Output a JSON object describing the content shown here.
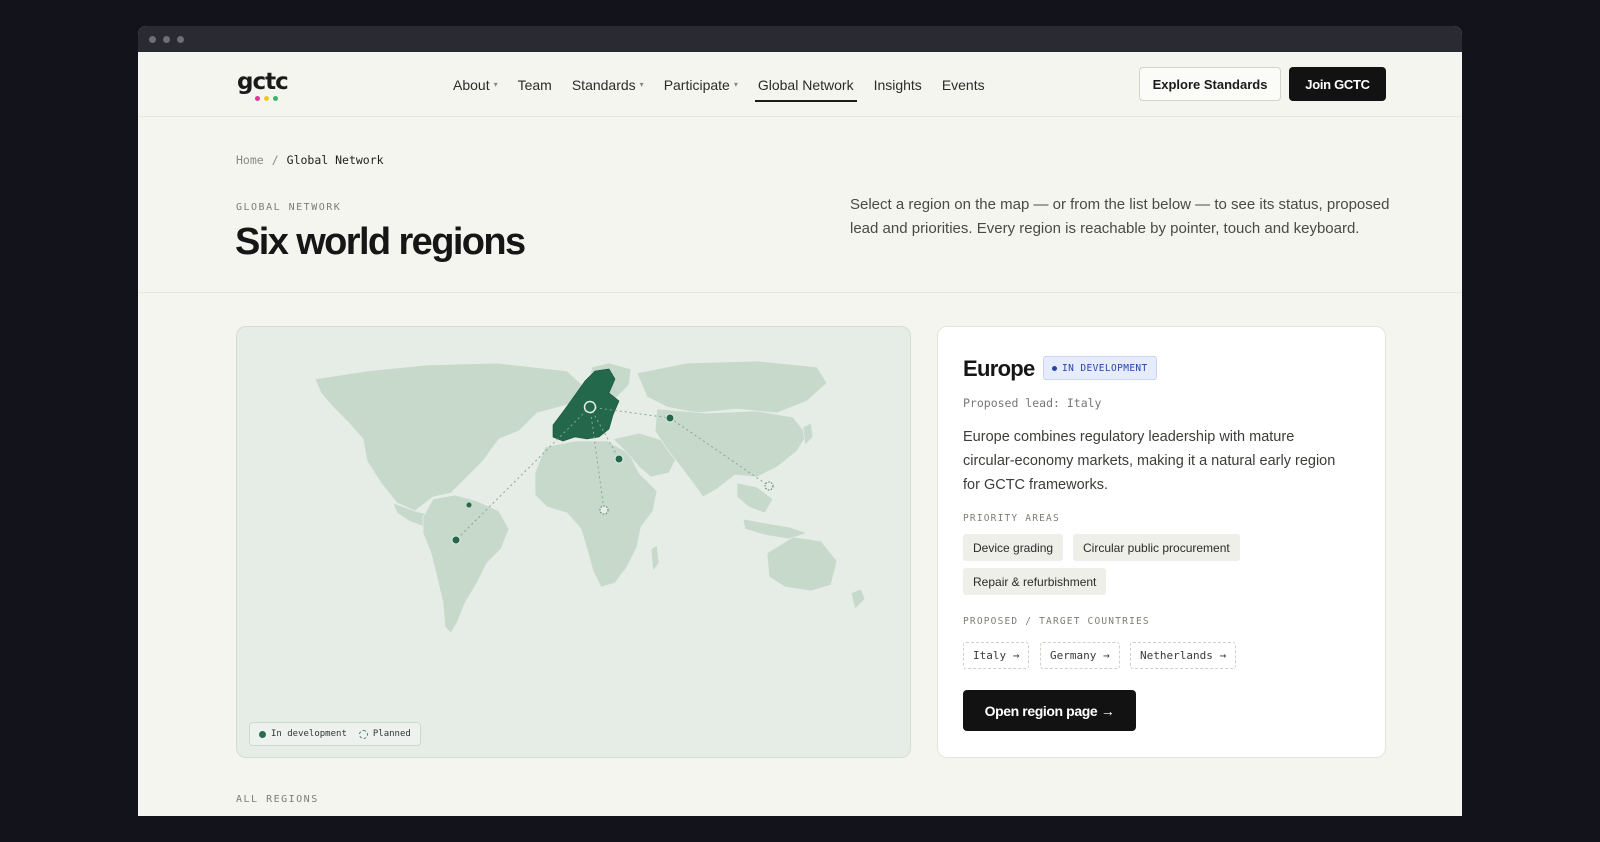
{
  "logo": {
    "text": "gctc",
    "dot_colors": [
      "#e0399a",
      "#f2c530",
      "#35b56a"
    ]
  },
  "nav": {
    "items": [
      {
        "label": "About",
        "dropdown": true
      },
      {
        "label": "Team",
        "dropdown": false
      },
      {
        "label": "Standards",
        "dropdown": true
      },
      {
        "label": "Participate",
        "dropdown": true
      },
      {
        "label": "Global Network",
        "dropdown": false,
        "active": true
      },
      {
        "label": "Insights",
        "dropdown": false
      },
      {
        "label": "Events",
        "dropdown": false
      }
    ],
    "explore_label": "Explore Standards",
    "join_label": "Join GCTC"
  },
  "breadcrumb": {
    "home": "Home",
    "separator": "/",
    "current": "Global Network"
  },
  "hero": {
    "eyebrow": "GLOBAL NETWORK",
    "title": "Six world regions",
    "lead": "Select a region on the map — or from the list below — to see its status, proposed lead and priorities. Every region is reachable by pointer, touch and keyboard."
  },
  "map": {
    "legend": {
      "in_development": "In development",
      "planned": "Planned"
    },
    "colors": {
      "land": "#c6d9ca",
      "highlight": "#23684a",
      "water": "#e6ece6"
    }
  },
  "panel": {
    "title": "Europe",
    "status": "IN DEVELOPMENT",
    "proposed_lead": "Proposed lead: Italy",
    "description": "Europe combines regulatory leadership with mature circular-economy markets, making it a natural early region for GCTC frameworks.",
    "priority_label": "PRIORITY AREAS",
    "priority_areas": [
      "Device grading",
      "Circular public procurement",
      "Repair & refurbishment"
    ],
    "countries_label": "PROPOSED / TARGET COUNTRIES",
    "countries": [
      "Italy →",
      "Germany →",
      "Netherlands →"
    ],
    "cta": "Open region page →"
  },
  "all_regions_label": "ALL REGIONS"
}
